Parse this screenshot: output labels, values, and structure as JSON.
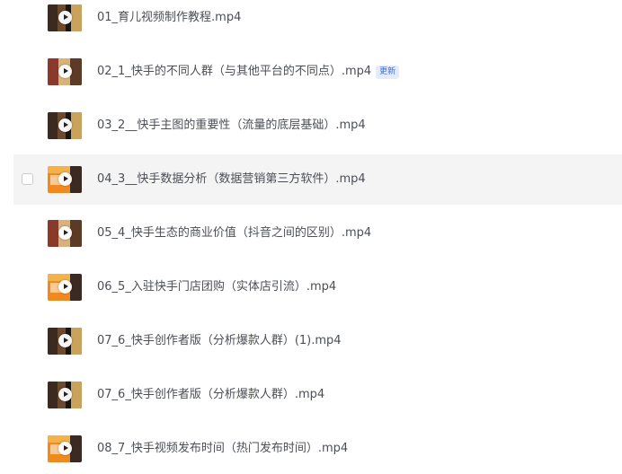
{
  "files": [
    {
      "name": "01_育儿视频制作教程.mp4",
      "thumb": "dark",
      "badge": ""
    },
    {
      "name": "02_1_快手的不同人群（与其他平台的不同点）.mp4",
      "thumb": "collage",
      "badge": "更新"
    },
    {
      "name": "03_2__快手主图的重要性（流量的底层基础）.mp4",
      "thumb": "dark",
      "badge": ""
    },
    {
      "name": "04_3__快手数据分析（数据营销第三方软件）.mp4",
      "thumb": "orange",
      "badge": ""
    },
    {
      "name": "05_4_快手生态的商业价值（抖音之间的区别）.mp4",
      "thumb": "collage",
      "badge": ""
    },
    {
      "name": "06_5_入驻快手门店团购（实体店引流）.mp4",
      "thumb": "orange",
      "badge": ""
    },
    {
      "name": "07_6_快手创作者版（分析爆款人群）(1).mp4",
      "thumb": "dark",
      "badge": ""
    },
    {
      "name": "07_6_快手创作者版（分析爆款人群）.mp4",
      "thumb": "dark",
      "badge": ""
    },
    {
      "name": "08_7_快手视频发布时间（热门发布时间）.mp4",
      "thumb": "orange",
      "badge": ""
    }
  ]
}
